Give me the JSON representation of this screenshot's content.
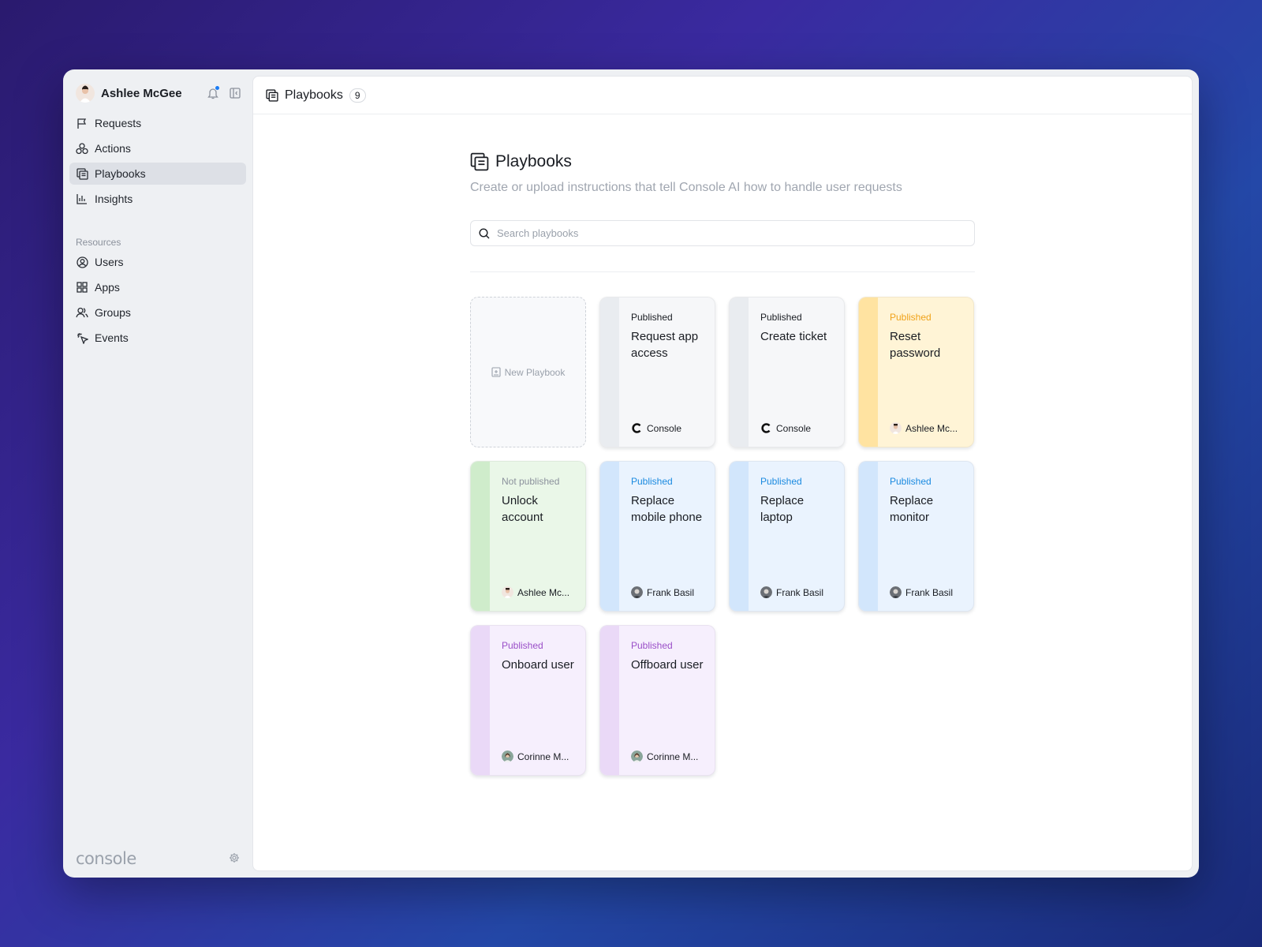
{
  "sidebar": {
    "user_name": "Ashlee McGee",
    "nav": [
      {
        "label": "Requests",
        "icon": "flag-icon"
      },
      {
        "label": "Actions",
        "icon": "actions-icon"
      },
      {
        "label": "Playbooks",
        "icon": "playbooks-icon",
        "active": true
      },
      {
        "label": "Insights",
        "icon": "bar-chart-icon"
      }
    ],
    "resources_label": "Resources",
    "resources": [
      {
        "label": "Users",
        "icon": "user-circle-icon"
      },
      {
        "label": "Apps",
        "icon": "grid-icon"
      },
      {
        "label": "Groups",
        "icon": "group-icon"
      },
      {
        "label": "Events",
        "icon": "cursor-click-icon"
      }
    ],
    "brand": "console"
  },
  "topbar": {
    "title": "Playbooks",
    "count": "9"
  },
  "page": {
    "title": "Playbooks",
    "subtitle": "Create or upload instructions that tell Console AI how to handle user requests",
    "search_placeholder": "Search playbooks"
  },
  "new_playbook_label": "New Playbook",
  "colors": {
    "accent": "#1a7cf5"
  },
  "playbooks": [
    {
      "status": "Published",
      "title": "Request app access",
      "owner": "Console",
      "theme": "gray"
    },
    {
      "status": "Published",
      "title": "Create ticket",
      "owner": "Console",
      "theme": "gray"
    },
    {
      "status": "Published",
      "title": "Reset password",
      "owner": "Ashlee Mc...",
      "theme": "yellow"
    },
    {
      "status": "Not published",
      "title": "Unlock account",
      "owner": "Ashlee Mc...",
      "theme": "green"
    },
    {
      "status": "Published",
      "title": "Replace mobile phone",
      "owner": "Frank Basil",
      "theme": "blue"
    },
    {
      "status": "Published",
      "title": "Replace laptop",
      "owner": "Frank Basil",
      "theme": "blue"
    },
    {
      "status": "Published",
      "title": "Replace monitor",
      "owner": "Frank Basil",
      "theme": "blue"
    },
    {
      "status": "Published",
      "title": "Onboard user",
      "owner": "Corinne M...",
      "theme": "purple"
    },
    {
      "status": "Published",
      "title": "Offboard user",
      "owner": "Corinne M...",
      "theme": "purple"
    }
  ]
}
